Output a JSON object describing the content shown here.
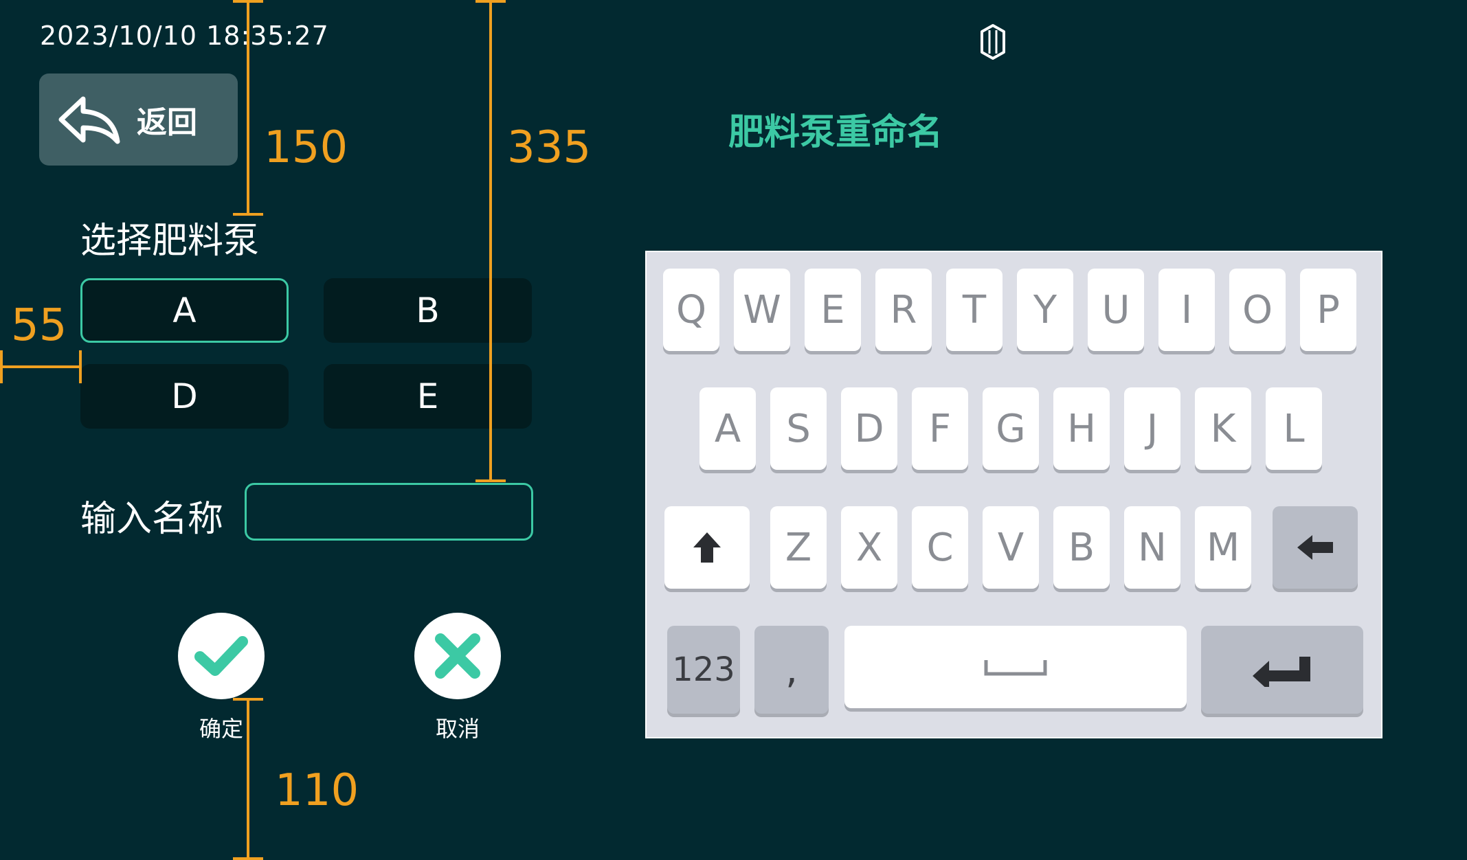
{
  "header": {
    "datetime": "2023/10/10 18:35:27",
    "title": "肥料泵重命名",
    "logo_icon": "hexagon-logo-icon",
    "back_label": "返回",
    "back_icon": "back-arrow-icon"
  },
  "pump_select": {
    "label": "选择肥料泵",
    "pumps": [
      {
        "label": "A",
        "selected": true
      },
      {
        "label": "B",
        "selected": false
      },
      {
        "label": "D",
        "selected": false
      },
      {
        "label": "E",
        "selected": false
      }
    ]
  },
  "name_input": {
    "label": "输入名称",
    "value": "",
    "placeholder": ""
  },
  "actions": {
    "confirm_label": "确定",
    "cancel_label": "取消"
  },
  "annotations": [
    "150",
    "335",
    "55",
    "110"
  ],
  "keyboard": {
    "row1": [
      "Q",
      "W",
      "E",
      "R",
      "T",
      "Y",
      "U",
      "I",
      "O",
      "P"
    ],
    "row2": [
      "A",
      "S",
      "D",
      "F",
      "G",
      "H",
      "J",
      "K",
      "L"
    ],
    "row3": [
      "Z",
      "X",
      "C",
      "V",
      "B",
      "N",
      "M"
    ],
    "numbers_key": "123",
    "comma_key": ",",
    "shift_icon": "shift-arrow-icon",
    "backspace_icon": "backspace-icon",
    "space_icon": "space-bar-icon",
    "enter_icon": "enter-return-icon"
  },
  "colors": {
    "background": "#022930",
    "accent": "#3cc9a4",
    "annotation": "#f0a020"
  }
}
